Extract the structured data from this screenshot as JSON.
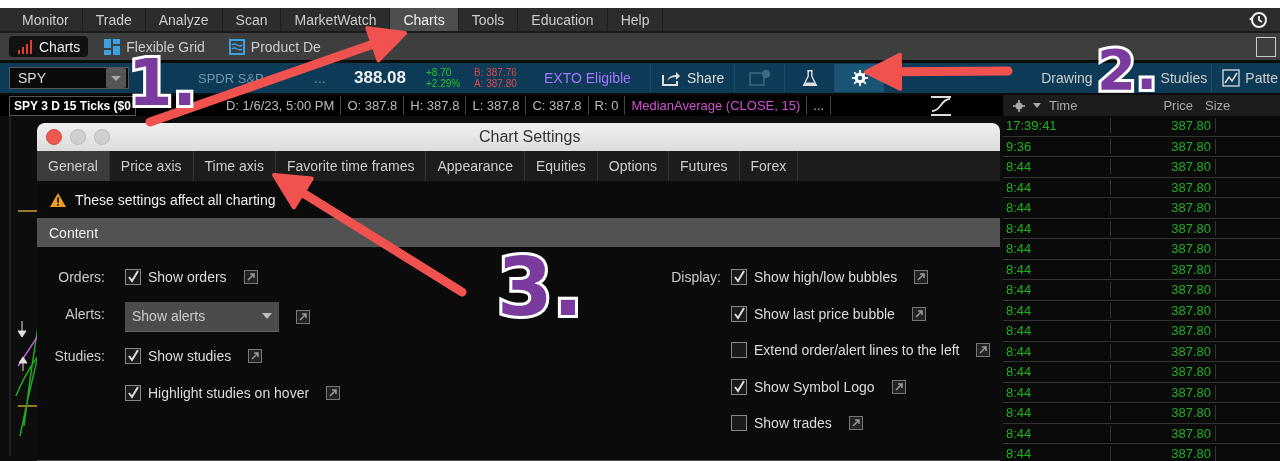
{
  "menu_tabs": [
    {
      "label": "Monitor",
      "selected": false
    },
    {
      "label": "Trade",
      "selected": false
    },
    {
      "label": "Analyze",
      "selected": false
    },
    {
      "label": "Scan",
      "selected": false
    },
    {
      "label": "MarketWatch",
      "selected": false
    },
    {
      "label": "Charts",
      "selected": true
    },
    {
      "label": "Tools",
      "selected": false
    },
    {
      "label": "Education",
      "selected": false
    },
    {
      "label": "Help",
      "selected": false
    }
  ],
  "sub_tabs": [
    {
      "label": "Charts",
      "kind": "bars",
      "selected": true
    },
    {
      "label": "Flexible Grid",
      "kind": "grid",
      "selected": false
    },
    {
      "label": "Product De",
      "kind": "depth",
      "selected": false
    }
  ],
  "corner_checkbox": {
    "checked": false
  },
  "quote_bar": {
    "symbol": "SPY",
    "description": "SPDR S&P",
    "description_more": "...",
    "last": "388.08",
    "change": "+8.70",
    "change_pct": "+2.29%",
    "bid": "B: 387.76",
    "ask": "A: 387.80",
    "badge": "EXTO Eligible",
    "share": "Share",
    "icon_buttons": [
      {
        "kind": "message",
        "selected": false
      },
      {
        "kind": "flask",
        "selected": false
      },
      {
        "kind": "gear",
        "selected": true
      }
    ],
    "right_buttons": [
      {
        "kind": "text",
        "label": "Drawing"
      },
      {
        "kind": "text",
        "label": "Studies"
      },
      {
        "kind": "pattern",
        "label": "Patte"
      }
    ]
  },
  "info_bar": {
    "title": "SPY 3 D 15 Ticks ($0",
    "fields": [
      "D: 1/6/23, 5:00 PM",
      "O: 387.8",
      "H: 387.8",
      "L: 387.8",
      "C: 387.8",
      "R: 0"
    ],
    "study": "MedianAverage (CLOSE, 15)",
    "more": "..."
  },
  "time_sales": {
    "columns": [
      "Time",
      "Price",
      "Size"
    ],
    "rows": [
      {
        "time": "17:39:41",
        "price": "387.80"
      },
      {
        "time": "9:36",
        "price": "387.80"
      },
      {
        "time": "8:44",
        "price": "387.80"
      },
      {
        "time": "8:44",
        "price": "387.80"
      },
      {
        "time": "8:44",
        "price": "387.80"
      },
      {
        "time": "8:44",
        "price": "387.80"
      },
      {
        "time": "8:44",
        "price": "387.80"
      },
      {
        "time": "8:44",
        "price": "387.80"
      },
      {
        "time": "8:44",
        "price": "387.80"
      },
      {
        "time": "8:44",
        "price": "387.80"
      },
      {
        "time": "8:44",
        "price": "387.80"
      },
      {
        "time": "8:44",
        "price": "387.80"
      },
      {
        "time": "8:44",
        "price": "387.80"
      },
      {
        "time": "8:44",
        "price": "387.80"
      },
      {
        "time": "8:44",
        "price": "387.80"
      },
      {
        "time": "8:44",
        "price": "387.80"
      },
      {
        "time": "8:44",
        "price": "387.80"
      }
    ]
  },
  "dialog": {
    "title": "Chart Settings",
    "tabs": [
      {
        "label": "General",
        "selected": true
      },
      {
        "label": "Price axis",
        "selected": false
      },
      {
        "label": "Time axis",
        "selected": false
      },
      {
        "label": "Favorite time frames",
        "selected": false
      },
      {
        "label": "Appearance",
        "selected": false
      },
      {
        "label": "Equities",
        "selected": false
      },
      {
        "label": "Options",
        "selected": false
      },
      {
        "label": "Futures",
        "selected": false
      },
      {
        "label": "Forex",
        "selected": false
      }
    ],
    "notice": "These settings affect all charting",
    "section": "Content",
    "left_groups": [
      {
        "label": "Orders:",
        "kind": "checks",
        "options": [
          {
            "label": "Show orders",
            "checked": true
          }
        ]
      },
      {
        "label": "Alerts:",
        "kind": "dropdown",
        "value": "Show alerts"
      },
      {
        "label": "Studies:",
        "kind": "checks",
        "options": [
          {
            "label": "Show studies",
            "checked": true
          },
          {
            "label": "Highlight studies on hover",
            "checked": true
          }
        ]
      }
    ],
    "right_groups": [
      {
        "label": "Display:",
        "kind": "checks",
        "options": [
          {
            "label": "Show high/low bubbles",
            "checked": true
          },
          {
            "label": "Show last price bubble",
            "checked": true
          },
          {
            "label": "Extend order/alert lines to the left",
            "checked": false
          },
          {
            "label": "Show Symbol Logo",
            "checked": true
          },
          {
            "label": "Show trades",
            "checked": false
          }
        ]
      }
    ]
  },
  "annotations": [
    {
      "number": "1."
    },
    {
      "number": "2."
    },
    {
      "number": "3."
    }
  ]
}
